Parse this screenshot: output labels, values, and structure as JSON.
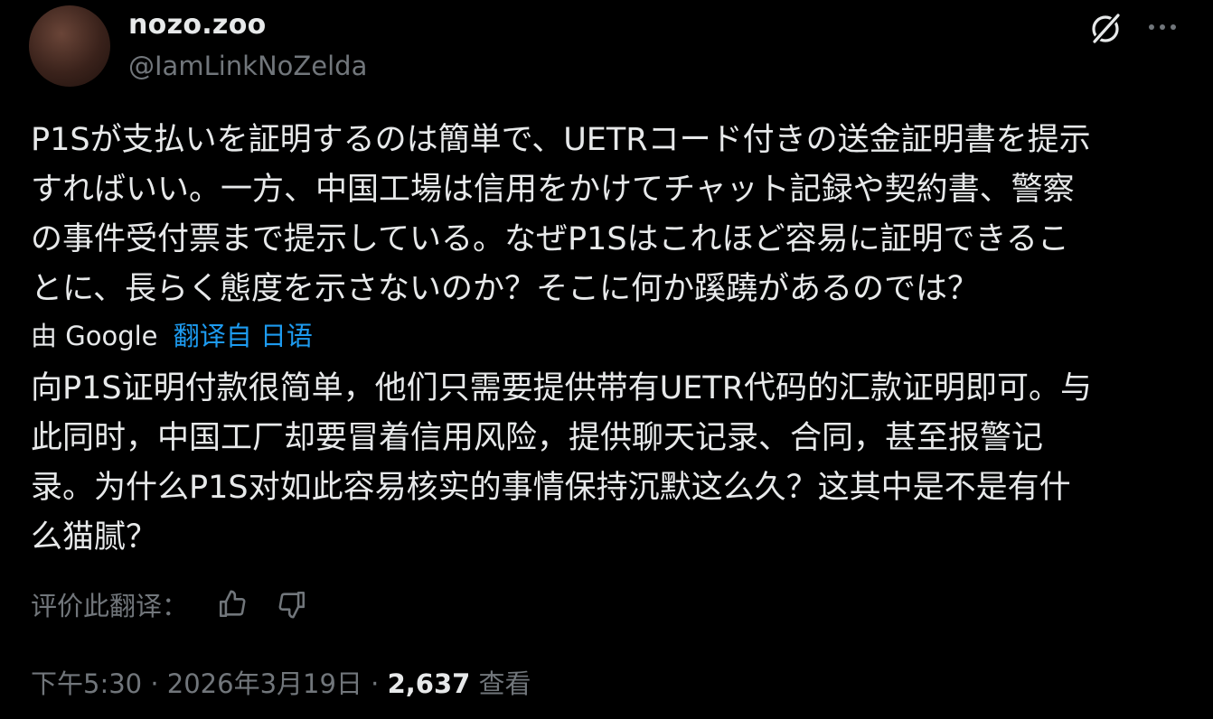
{
  "author": {
    "display_name": "nozo.zoo",
    "handle": "@IamLinkNoZelda",
    "avatar_icon": "avatar-image"
  },
  "header_icons": [
    "grok-icon",
    "more-icon"
  ],
  "post": {
    "original_lines": [
      "P1Sが支払いを証明するのは簡単で、UETRコード付きの送金証明書を提示",
      "すればいい。一方、中国工場は信用をかけてチャット記録や契約書、警察",
      "の事件受付票まで提示している。なぜP1Sはこれほど容易に証明できるこ",
      "とに、長らく態度を示さないのか？そこに何か蹊蹺があるのでは？"
    ],
    "translation_prefix": "由",
    "translation_provider": "Google",
    "translation_source": "翻译自 日语",
    "translated_lines": [
      "向P1S证明付款很简单，他们只需要提供带有UETR代码的汇款证明即可。与",
      "此同时，中国工厂却要冒着信用风险，提供聊天记录、合同，甚至报警记",
      "录。为什么P1S对如此容易核实的事情保持沉默这么久？这其中是不是有什",
      "么猫腻？"
    ]
  },
  "rate_translation": {
    "label": "评价此翻译：",
    "icons": [
      "thumbs-up-icon",
      "thumbs-down-icon"
    ]
  },
  "meta": {
    "time": "下午5:30",
    "separator": "·",
    "date": "2026年3月19日",
    "views_count": "2,637",
    "views_label": "查看"
  },
  "colors": {
    "background": "#000000",
    "text": "#e7e9ea",
    "secondary": "#71767b",
    "link": "#1d9bf0"
  }
}
